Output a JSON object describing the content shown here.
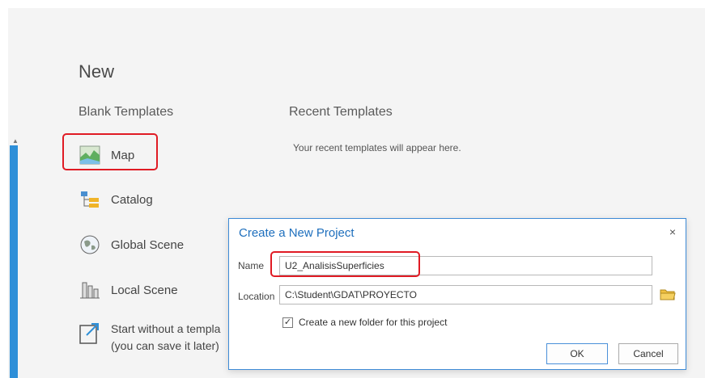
{
  "page": {
    "heading": "New",
    "blank_templates": "Blank Templates",
    "recent_templates": "Recent Templates",
    "recent_message": "Your recent templates will appear here."
  },
  "templates": {
    "map": "Map",
    "catalog": "Catalog",
    "global_scene": "Global Scene",
    "local_scene": "Local Scene",
    "start_line1": "Start without a templa",
    "start_line2": "(you can save it later)"
  },
  "dialog": {
    "title": "Create a New Project",
    "close_glyph": "×",
    "name_label": "Name",
    "name_value": "U2_AnalisisSuperficies",
    "location_label": "Location",
    "location_value": "C:\\Student\\GDAT\\PROYECTO",
    "checkbox_checked": true,
    "checkbox_glyph": "✓",
    "checkbox_label": "Create a new folder for this project",
    "ok_label": "OK",
    "cancel_label": "Cancel"
  },
  "colors": {
    "accent_blue": "#2e8fd8",
    "dialog_title": "#1e6fbd",
    "highlight_red": "#e01b24"
  },
  "icons": [
    "map-icon",
    "catalog-icon",
    "global-scene-icon",
    "local-scene-icon",
    "start-without-template-icon",
    "close-icon",
    "browse-folder-icon",
    "checkbox"
  ]
}
